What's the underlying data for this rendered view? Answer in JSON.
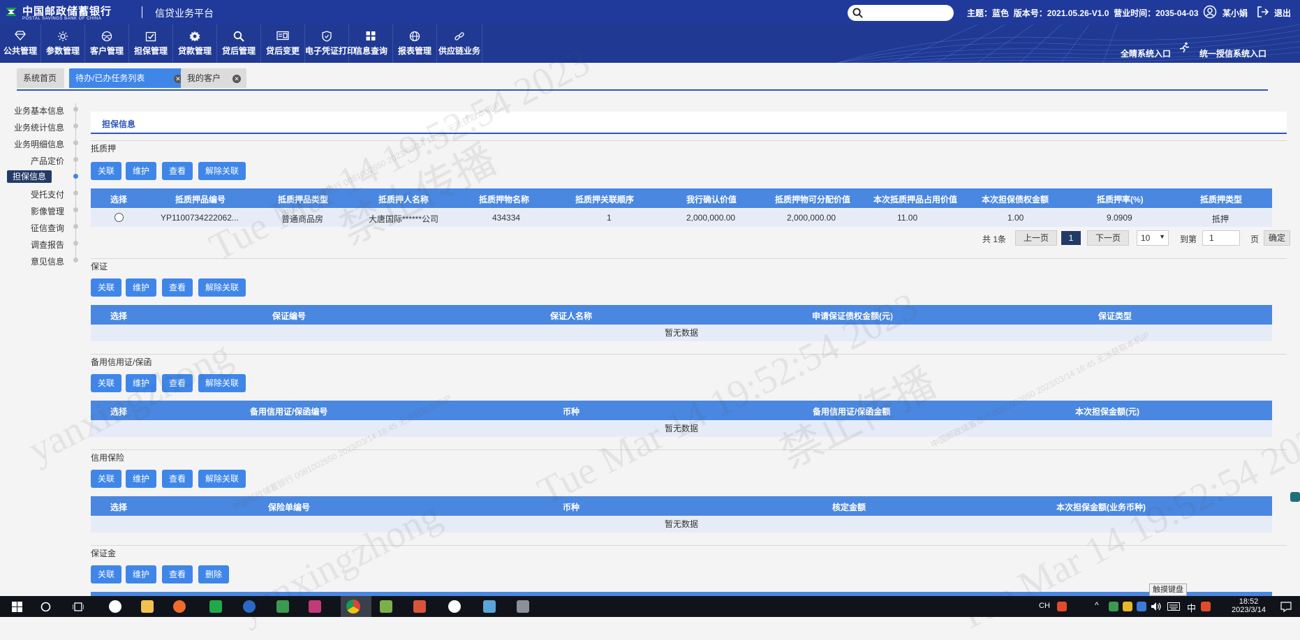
{
  "header": {
    "bank_name_cn": "中国邮政储蓄银行",
    "bank_name_en": "POSTAL SAVINGS BANK OF CHINA",
    "platform": "信贷业务平台",
    "theme": "主题：蓝色",
    "version": "版本号：2021.05.26-V1.0",
    "biz_time": "营业时间：2035-04-03",
    "user": "某小娟",
    "logout": "退出"
  },
  "nav": [
    {
      "label": "公共管理",
      "icon": "diamond-icon"
    },
    {
      "label": "参数管理",
      "icon": "sun-gear-icon"
    },
    {
      "label": "客户管理",
      "icon": "ball-icon"
    },
    {
      "label": "担保管理",
      "icon": "checkbox-icon"
    },
    {
      "label": "贷款管理",
      "icon": "gear-icon"
    },
    {
      "label": "贷后管理",
      "icon": "search-icon"
    },
    {
      "label": "贷后变更",
      "icon": "card-icon"
    },
    {
      "label": "电子凭证打印",
      "icon": "shield-icon"
    },
    {
      "label": "信息查询",
      "icon": "grid-icon"
    },
    {
      "label": "报表管理",
      "icon": "globe-icon"
    },
    {
      "label": "供应链业务",
      "icon": "link-icon"
    }
  ],
  "entries": [
    "全睛系统入口",
    "统一授信系统入口"
  ],
  "tabs": [
    {
      "label": "系统首页",
      "active": false,
      "closable": false
    },
    {
      "label": "待办/已办任务列表",
      "active": true,
      "closable": true
    },
    {
      "label": "我的客户",
      "active": false,
      "closable": true
    }
  ],
  "sidenav": [
    {
      "label": "业务基本信息",
      "active": false
    },
    {
      "label": "业务统计信息",
      "active": false
    },
    {
      "label": "业务明细信息",
      "active": false
    },
    {
      "label": "产品定价",
      "active": false
    },
    {
      "label": "担保信息",
      "active": true
    },
    {
      "label": "受托支付",
      "active": false
    },
    {
      "label": "影像管理",
      "active": false
    },
    {
      "label": "征信查询",
      "active": false
    },
    {
      "label": "调查报告",
      "active": false
    },
    {
      "label": "意见信息",
      "active": false
    }
  ],
  "page_title": "担保信息",
  "buttons": {
    "link": "关联",
    "maintain": "维护",
    "view": "查看",
    "unlink": "解除关联",
    "delete": "删除"
  },
  "empty_text": "暂无数据",
  "collateral": {
    "title": "抵质押",
    "columns": [
      "选择",
      "抵质押品编号",
      "抵质押品类型",
      "抵质押人名称",
      "抵质押物名称",
      "抵质押关联顺序",
      "我行确认价值",
      "抵质押物可分配价值",
      "本次抵质押品占用价值",
      "本次担保债权金额",
      "抵质押率(%)",
      "抵质押类型"
    ],
    "rows": [
      [
        "",
        "YP1100734222062...",
        "普通商品房",
        "大唐国际******公司",
        "434334",
        "1",
        "2,000,000.00",
        "2,000,000.00",
        "11.00",
        "1.00",
        "9.0909",
        "抵押"
      ]
    ],
    "pager": {
      "total": "共 1条",
      "prev": "上一页",
      "current": "1",
      "next": "下一页",
      "page_size": "10",
      "goto": "到第",
      "goto_value": "1",
      "page_unit": "页",
      "confirm": "确定"
    }
  },
  "guarantee": {
    "title": "保证",
    "columns": [
      "选择",
      "保证编号",
      "保证人名称",
      "申请保证债权金额(元)",
      "保证类型"
    ]
  },
  "standby": {
    "title": "备用信用证/保函",
    "columns": [
      "选择",
      "备用信用证/保函编号",
      "币种",
      "备用信用证/保函金额",
      "本次担保金额(元)"
    ]
  },
  "insurance": {
    "title": "信用保险",
    "columns": [
      "选择",
      "保险单编号",
      "币种",
      "核定金额",
      "本次担保金额(业务币种)"
    ]
  },
  "deposit": {
    "title": "保证金"
  },
  "watermark": {
    "big": [
      "Tue Mar 14 19:52:54 2023",
      "禁止传播",
      "yanxingzhong"
    ],
    "small": "中国邮政储蓄银行 0081002650 2023/03/14 18:45 无法获取本机IP"
  },
  "taskbar": {
    "time": "18:52",
    "date": "2023/3/14",
    "tooltip": "触摸键盘",
    "ime": "中",
    "lang": "CH"
  }
}
